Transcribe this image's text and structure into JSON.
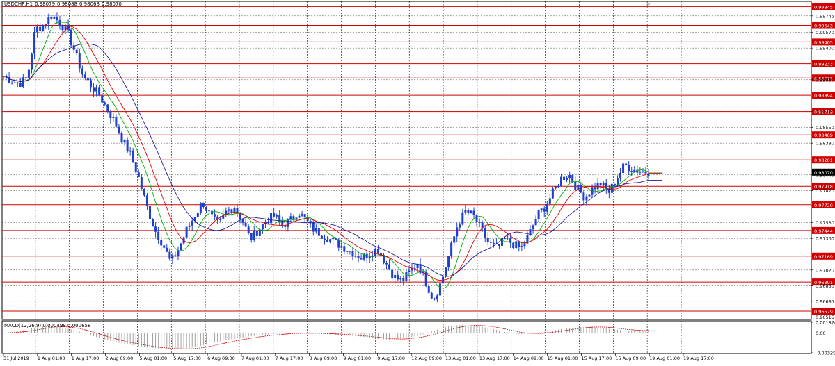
{
  "chart_header": {
    "symbol_timeframe": "USDCHF,H1",
    "open": "0.98079",
    "high": "0.98088",
    "low": "0.98068",
    "close": "0.98070"
  },
  "macd_header": {
    "label": "MACD(12,26,9)",
    "main": "0.000498",
    "signal": "0.000658"
  },
  "colors": {
    "candles": "#1f3fcf",
    "level_lines": "#d00000",
    "ma_fast": "#00b000",
    "ma_mid": "#e00000",
    "ma_slow": "#1a1a9a",
    "macd_hist": "#a0a0a0",
    "macd_signal": "#d00000",
    "price_tag_bg": "#d00000",
    "current_tag_bg": "#000000"
  },
  "chart_data": [
    {
      "type": "candlestick",
      "title": "USDCHF,H1",
      "price_axis_ticks": [
        "0.99745",
        "0.99570",
        "0.99400",
        "0.99060",
        "0.98720",
        "0.98550",
        "0.98380",
        "0.98040",
        "0.97870",
        "0.97530",
        "0.97360",
        "0.97020",
        "0.96850",
        "0.96685",
        "0.96515"
      ],
      "price_range": [
        0.9649,
        0.999
      ],
      "time_labels": [
        "31 Jul 2019",
        "1 Aug 01:00",
        "1 Aug 17:00",
        "2 Aug 09:00",
        "5 Aug 01:00",
        "5 Aug 17:00",
        "6 Aug 09:00",
        "7 Aug 01:00",
        "7 Aug 17:00",
        "8 Aug 09:00",
        "9 Aug 01:00",
        "9 Aug 17:00",
        "12 Aug 09:00",
        "13 Aug 01:00",
        "13 Aug 17:00",
        "14 Aug 09:00",
        "15 Aug 01:00",
        "15 Aug 17:00",
        "16 Aug 09:00",
        "19 Aug 01:00",
        "19 Aug 17:00"
      ],
      "horizontal_levels": [
        "0.99845",
        "0.99643",
        "0.99465",
        "0.99233",
        "0.99079",
        "0.98894",
        "0.98719",
        "0.98469",
        "0.98201",
        "0.97918",
        "0.97720",
        "0.97444",
        "0.97169",
        "0.96891",
        "0.96579"
      ],
      "current_price": "0.98070",
      "close_path": [
        0.991,
        0.9905,
        0.9902,
        0.9908,
        0.996,
        0.9965,
        0.9975,
        0.9968,
        0.9958,
        0.9935,
        0.991,
        0.99,
        0.989,
        0.9875,
        0.986,
        0.984,
        0.9825,
        0.98,
        0.977,
        0.9745,
        0.973,
        0.971,
        0.9725,
        0.9745,
        0.976,
        0.9775,
        0.976,
        0.975,
        0.9765,
        0.977,
        0.9755,
        0.9735,
        0.9745,
        0.9755,
        0.976,
        0.975,
        0.9755,
        0.9765,
        0.9755,
        0.9745,
        0.974,
        0.9735,
        0.973,
        0.9725,
        0.972,
        0.9715,
        0.972,
        0.9725,
        0.971,
        0.9695,
        0.969,
        0.97,
        0.971,
        0.969,
        0.967,
        0.969,
        0.972,
        0.975,
        0.9765,
        0.976,
        0.9745,
        0.973,
        0.9725,
        0.9735,
        0.973,
        0.9725,
        0.974,
        0.976,
        0.977,
        0.9785,
        0.98,
        0.9805,
        0.979,
        0.978,
        0.979,
        0.9795,
        0.9785,
        0.98,
        0.9815,
        0.981,
        0.9808,
        0.9807
      ],
      "indicators": [
        "moving average fast (green)",
        "moving average mid (red)",
        "moving average slow (navy)"
      ]
    },
    {
      "type": "bar",
      "title": "MACD(12,26,9)",
      "axis_ticks": [
        "0.001824",
        "0.00",
        "-0.003298"
      ],
      "histogram_path": [
        0.0,
        0.0003,
        0.0008,
        0.0012,
        0.001,
        0.0005,
        -0.0003,
        -0.001,
        -0.0016,
        -0.002,
        -0.0024,
        -0.0026,
        -0.0027,
        -0.0025,
        -0.002,
        -0.0014,
        -0.001,
        -0.0006,
        -0.0003,
        -0.0001,
        0.0,
        0.0,
        -0.0001,
        -0.0002,
        -0.0004,
        -0.0006,
        -0.0009,
        -0.0011,
        -0.0008,
        -0.0004,
        0.0004,
        0.0011,
        0.0014,
        0.0012,
        0.0008,
        0.0002,
        -0.0002,
        0.0,
        0.0003,
        0.0007,
        0.001,
        0.0011,
        0.0008,
        0.0005,
        0.0004,
        0.0005
      ],
      "series": [
        {
          "name": "MACD main (histogram)"
        },
        {
          "name": "Signal (dotted)"
        }
      ]
    }
  ]
}
